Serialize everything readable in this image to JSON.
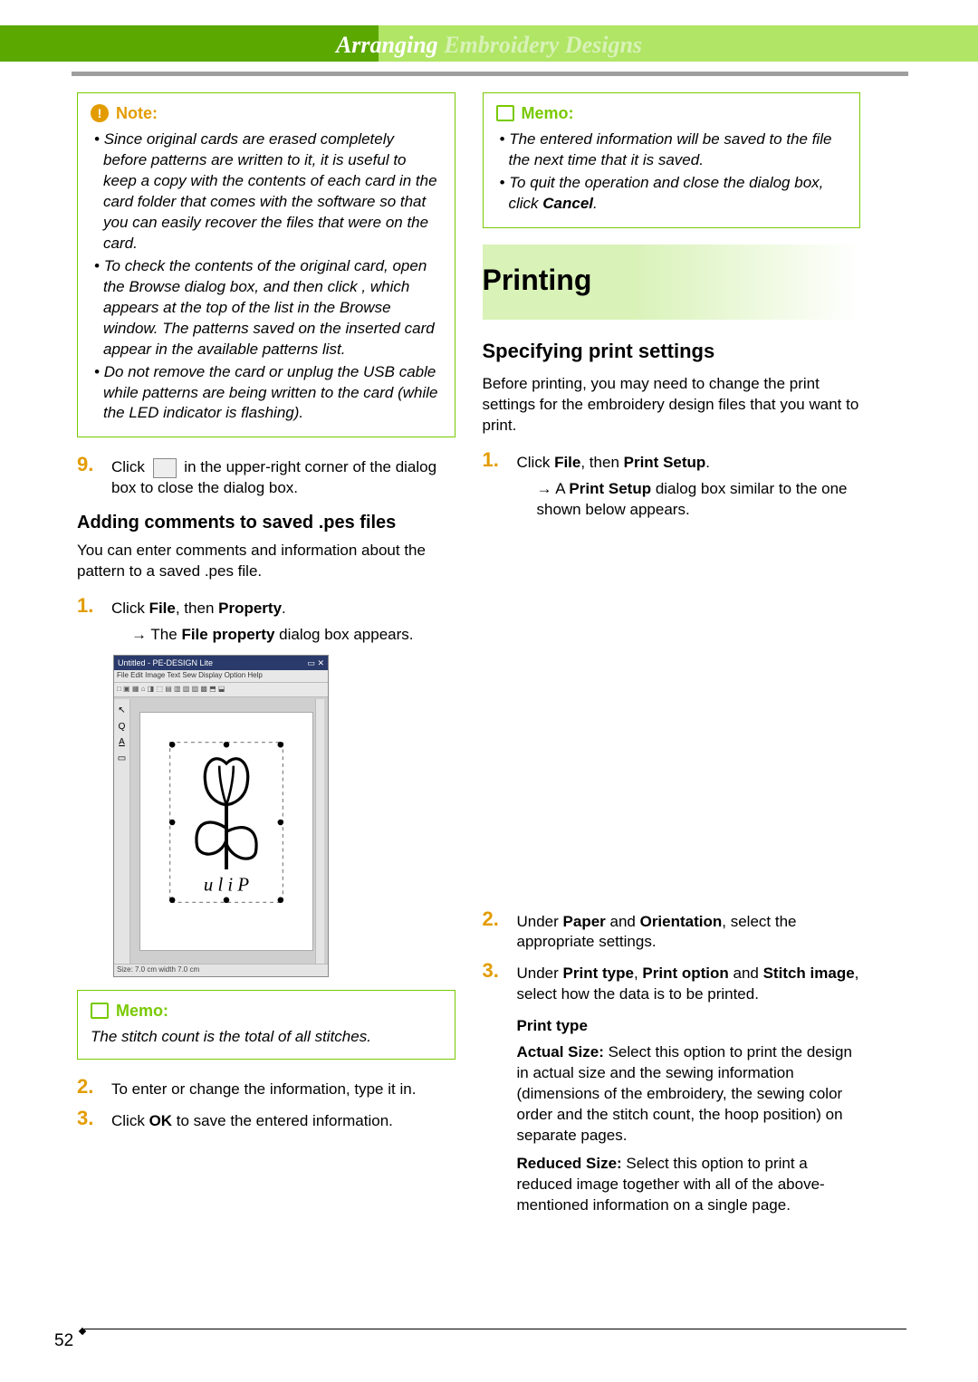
{
  "header": {
    "textDark": "Arranging ",
    "textLight": "Embroidery Designs"
  },
  "note": {
    "title": "Note:",
    "items": [
      "Since original cards are erased completely before patterns are written to it, it is useful to keep a copy with the contents of each card in the card folder that comes with the software so that you can easily recover the files that were on the card.",
      "To check the contents of the original card, open the Browse dialog box, and then click        , which appears at the top of the list in the Browse window. The patterns saved on the inserted card appear in the available patterns list.",
      "Do not remove the card or unplug the USB cable while patterns are being written to the card (while the LED indicator is flashing)."
    ]
  },
  "step9": {
    "num": "9.",
    "pre": "Click ",
    "post": " in the upper-right corner of the dialog box to close the dialog box."
  },
  "addingHeading": "Adding comments to saved .pes files",
  "addingIntro": "You can enter comments and information about the pattern to a saved .pes file.",
  "add1": {
    "num": "1.",
    "pre": "Click ",
    "b1": "File",
    "mid": ", then ",
    "b2": "Property",
    "post": "."
  },
  "add1_arrow": {
    "pre": "→ The ",
    "b": "File property",
    "post": " dialog box appears."
  },
  "screenshot": {
    "title": "Untitled - PE-DESIGN Lite",
    "menu": "File  Edit  Image  Text  Sew  Display  Option  Help",
    "status": "Size: 7.0 cm   width 7.0 cm",
    "caption": "u l i P"
  },
  "memo1": {
    "title": "Memo:",
    "text": "The stitch count is the total of all stitches."
  },
  "add2": {
    "num": "2.",
    "text": "To enter or change the information, type it in."
  },
  "add3": {
    "num": "3.",
    "pre": "Click ",
    "b": "OK",
    "post": " to save the entered information."
  },
  "memo2": {
    "title": "Memo:",
    "items": [
      "The entered information will be saved to the file the next time that it is saved.",
      "To quit the operation and close the dialog box, click Cancel."
    ]
  },
  "printingHeading": "Printing",
  "specHeading": "Specifying print settings",
  "specIntro": "Before printing, you may need to change the print settings for the embroidery design files that you want to print.",
  "p1": {
    "num": "1.",
    "pre": "Click ",
    "b1": "File",
    "mid": ", then ",
    "b2": "Print Setup",
    "post": "."
  },
  "p1_arrow": {
    "pre": "→ A ",
    "b": "Print Setup",
    "post": " dialog box similar to the one shown below appears."
  },
  "p2": {
    "num": "2.",
    "pre": "Under ",
    "b1": "Paper",
    "mid": " and ",
    "b2": "Orientation",
    "post": ", select the appropriate settings."
  },
  "p3": {
    "num": "3.",
    "pre": "Under ",
    "b1": "Print type",
    "mid1": ", ",
    "b2": "Print option",
    "mid2": " and ",
    "b3": "Stitch image",
    "post": ", select how the data is to be printed."
  },
  "printType": {
    "heading": "Print type",
    "actualLabel": "Actual Size:",
    "actualText": " Select this option to print the design in actual size and the sewing information (dimensions of the embroidery, the sewing color order and the stitch count, the hoop position) on separate pages.",
    "reducedLabel": "Reduced Size:",
    "reducedText": " Select this option to print a reduced image together with all of the above-mentioned information on a single page."
  },
  "pageNumber": "52"
}
